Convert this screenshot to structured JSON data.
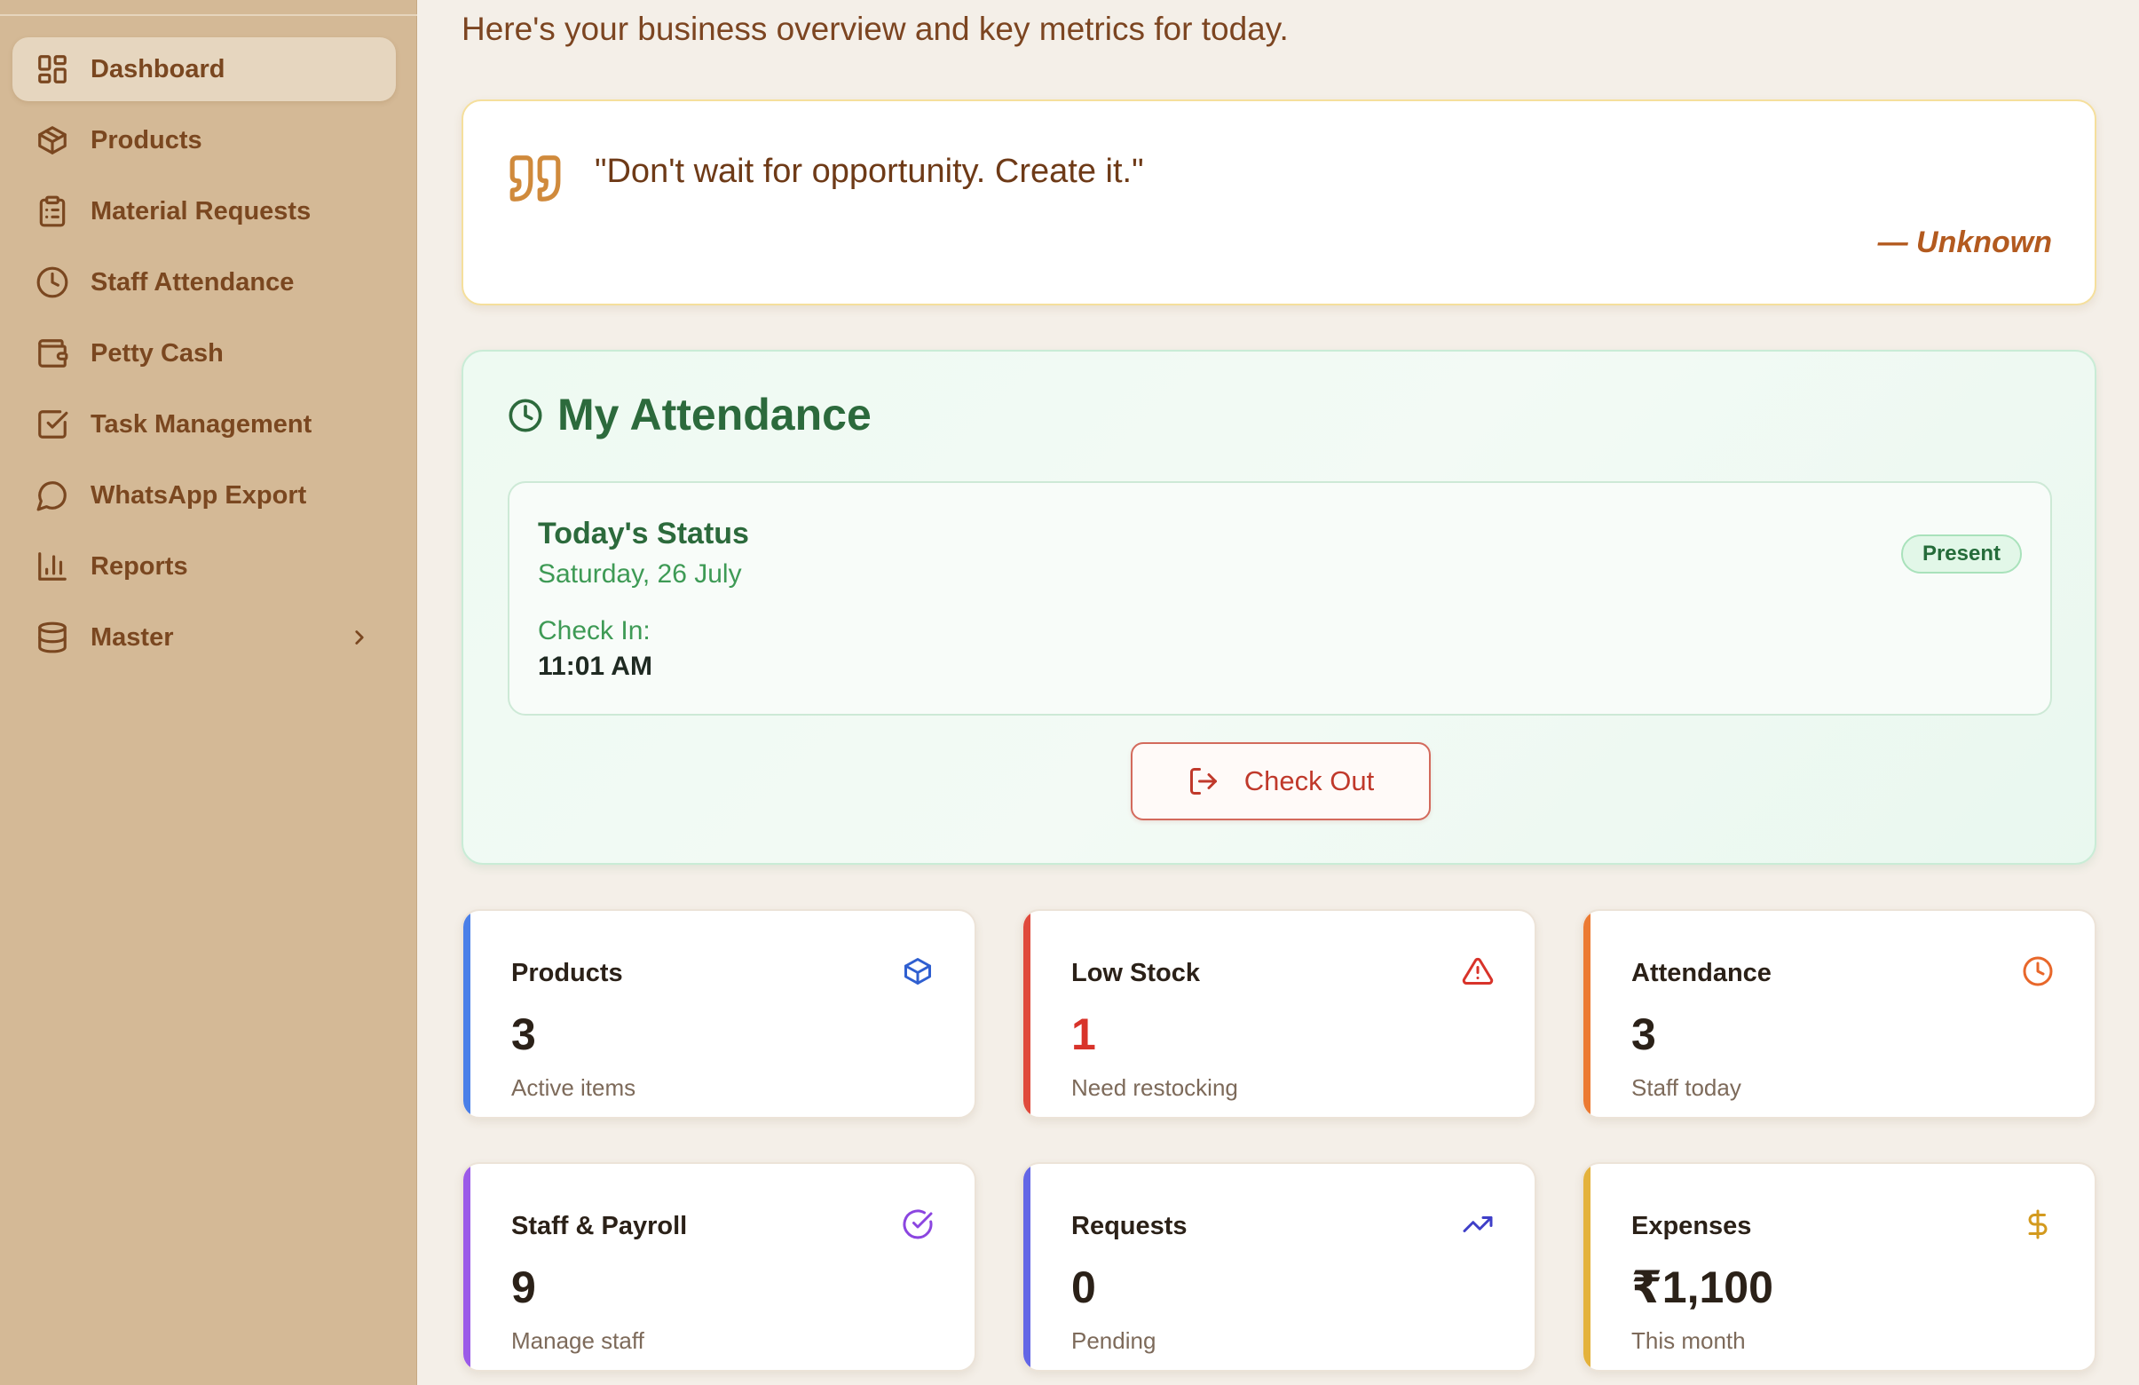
{
  "sidebar": {
    "items": [
      {
        "label": "Dashboard",
        "icon": "dashboard-grid-icon",
        "active": true
      },
      {
        "label": "Products",
        "icon": "package-icon"
      },
      {
        "label": "Material Requests",
        "icon": "clipboard-list-icon"
      },
      {
        "label": "Staff Attendance",
        "icon": "clock-icon"
      },
      {
        "label": "Petty Cash",
        "icon": "wallet-icon"
      },
      {
        "label": "Task Management",
        "icon": "check-square-icon"
      },
      {
        "label": "WhatsApp Export",
        "icon": "message-circle-icon"
      },
      {
        "label": "Reports",
        "icon": "bar-chart-icon"
      },
      {
        "label": "Master",
        "icon": "database-icon",
        "has_submenu": true
      }
    ]
  },
  "header": {
    "subtitle": "Here's your business overview and key metrics for today."
  },
  "quote": {
    "text": "\"Don't wait for opportunity. Create it.\"",
    "author": "— Unknown"
  },
  "attendance": {
    "title": "My Attendance",
    "status_title": "Today's Status",
    "date": "Saturday, 26 July",
    "badge": "Present",
    "check_in_label": "Check In:",
    "check_in_time": "11:01 AM",
    "checkout_label": "Check Out"
  },
  "stats": [
    {
      "title": "Products",
      "value": "3",
      "sub": "Active items",
      "accent": "#4a7fe8",
      "icon": "package-icon",
      "icon_color": "#2f5fd0"
    },
    {
      "title": "Low Stock",
      "value": "1",
      "sub": "Need restocking",
      "accent": "#e04a3c",
      "icon": "alert-triangle-icon",
      "icon_color": "#d8332a",
      "value_color": "#d8332a"
    },
    {
      "title": "Attendance",
      "value": "3",
      "sub": "Staff today",
      "accent": "#ec7a32",
      "icon": "clock-icon",
      "icon_color": "#e8672a"
    },
    {
      "title": "Staff & Payroll",
      "value": "9",
      "sub": "Manage staff",
      "accent": "#9b5ae8",
      "icon": "circle-check-icon",
      "icon_color": "#8b45e0"
    },
    {
      "title": "Requests",
      "value": "0",
      "sub": "Pending",
      "accent": "#6366e6",
      "icon": "trending-up-icon",
      "icon_color": "#3f3fc8"
    },
    {
      "title": "Expenses",
      "value": "₹1,100",
      "sub": "This month",
      "accent": "#e4b23c",
      "icon": "dollar-sign-icon",
      "icon_color": "#d39a1e"
    }
  ]
}
